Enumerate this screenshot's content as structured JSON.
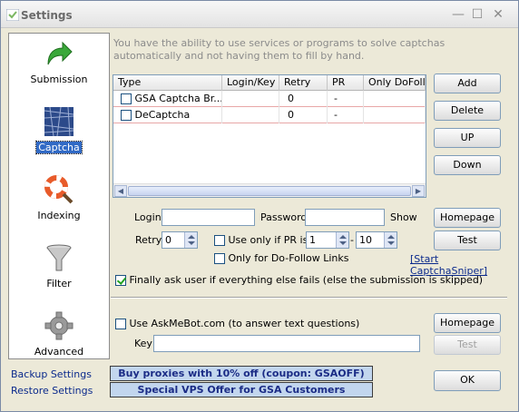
{
  "window": {
    "title": "Settings",
    "minimize": "—",
    "maximize": "☐",
    "close": "✕"
  },
  "sidebar": {
    "items": [
      {
        "label": "Submission",
        "icon": "green-arrow-icon"
      },
      {
        "label": "Captcha",
        "icon": "captcha-icon",
        "selected": true
      },
      {
        "label": "Indexing",
        "icon": "lifebuoy-magnifier-icon"
      },
      {
        "label": "Filter",
        "icon": "funnel-icon"
      },
      {
        "label": "Advanced",
        "icon": "gear-icon"
      }
    ],
    "backup_link": "Backup Settings",
    "restore_link": "Restore Settings"
  },
  "description": "You have the ability to use services or programs to solve captchas automatically and not having them to fill by hand.",
  "grid": {
    "columns": [
      "Type",
      "Login/Key",
      "Retry",
      "PR",
      "Only DoFollow"
    ],
    "rows": [
      {
        "checked": false,
        "type": "GSA Captcha Br...",
        "login": "",
        "retry": "0",
        "pr": "-",
        "dofollow": ""
      },
      {
        "checked": false,
        "type": "DeCaptcha",
        "login": "",
        "retry": "0",
        "pr": "-",
        "dofollow": ""
      }
    ]
  },
  "buttons": {
    "add": "Add",
    "delete": "Delete",
    "up": "UP",
    "down": "Down",
    "homepage": "Homepage",
    "test": "Test",
    "homepage2": "Homepage",
    "test2": "Test",
    "ok": "OK"
  },
  "form": {
    "login_label": "Login",
    "login_value": "",
    "password_label": "Password",
    "password_value": "",
    "show_label": "Show",
    "retry_label": "Retry",
    "retry_value": "0",
    "use_pr_label": "Use only if PR is",
    "use_pr_checked": false,
    "pr_from": "1",
    "pr_sep": "-",
    "pr_to": "10",
    "dofollow_label": "Only for Do-Follow Links",
    "dofollow_checked": false,
    "start_captchasniper": "[Start CaptchaSniper]",
    "finally_label": "Finally ask user if everything else fails (else the submission is skipped)",
    "finally_checked": true
  },
  "askme": {
    "label": "Use AskMeBot.com (to answer text questions)",
    "checked": false,
    "key_label": "Key",
    "key_value": ""
  },
  "banners": {
    "proxies": "Buy proxies with 10% off  (coupon: GSAOFF)",
    "vps": "Special VPS Offer for GSA Customers"
  }
}
